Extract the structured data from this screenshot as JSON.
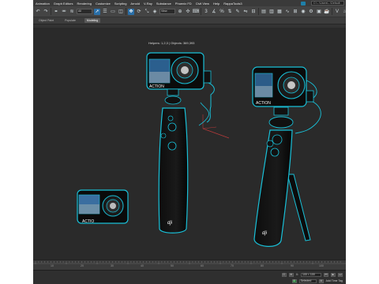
{
  "app": {
    "menu": [
      "Animation",
      "Graph Editors",
      "Rendering",
      "Customize",
      "Scripting",
      "Arnold",
      "V-Ray",
      "Substance",
      "Phoenix FD",
      "Civil View",
      "Help",
      "RappaTools3"
    ],
    "workspace_field": "C:\\...\\Users\\...\\Default",
    "toolbar": {
      "select_filter": "All",
      "view_dropdown": "View"
    },
    "ribbon_tabs": [
      {
        "label": "Object Paint"
      },
      {
        "label": "Populate"
      },
      {
        "label": "Modeling",
        "active": true
      }
    ]
  },
  "viewport": {
    "stats": "Helpers: 1,2,3 | Objects: 369,393"
  },
  "scene": {
    "cameras": [
      {
        "name": "camera-left-small",
        "label": "ACTIO"
      },
      {
        "name": "camera-center-top",
        "label": "ACTION"
      },
      {
        "name": "camera-right-top",
        "label": "ACTION"
      }
    ],
    "grip_logo": "dji"
  },
  "timeline": {
    "ticks": [
      "10",
      "20",
      "30",
      "40",
      "50",
      "60",
      "70",
      "80",
      "90",
      "100"
    ]
  },
  "statusbar": {
    "x_value": "X:",
    "coord_value": "100 < 100",
    "mode": "Selected",
    "addtime": "Add Time Tag"
  },
  "colors": {
    "wire": "#19c0d8",
    "viewport_bg": "#2a2a2a",
    "accent": "#2a6fa8"
  }
}
